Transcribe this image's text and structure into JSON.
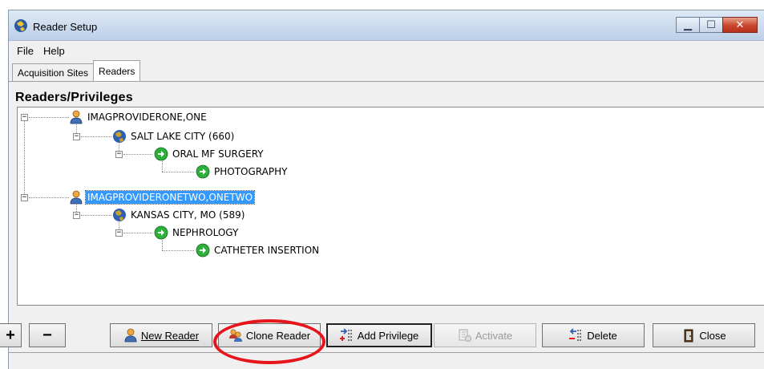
{
  "window": {
    "title": "Reader Setup",
    "controls": {
      "minimize": "▁",
      "maximize": "☐",
      "close": "✕"
    }
  },
  "menu": [
    "File",
    "Help"
  ],
  "tabs": [
    {
      "label": "Acquisition Sites",
      "active": false
    },
    {
      "label": "Readers",
      "active": true
    }
  ],
  "section_title": "Readers/Privileges",
  "tree": {
    "nodes": [
      {
        "label": "IMAGPROVIDERONE,ONE",
        "icon": "person-icon",
        "selected": false
      },
      {
        "label": "SALT LAKE CITY (660)",
        "icon": "globe-icon",
        "selected": false
      },
      {
        "label": "ORAL MF SURGERY",
        "icon": "green-arrow-icon",
        "selected": false
      },
      {
        "label": "PHOTOGRAPHY",
        "icon": "green-arrow-icon",
        "selected": false
      },
      {
        "label": "IMAGPROVIDERONETWO,ONETWO",
        "icon": "person-icon",
        "selected": true
      },
      {
        "label": "KANSAS CITY, MO (589)",
        "icon": "globe-icon",
        "selected": false
      },
      {
        "label": "NEPHROLOGY",
        "icon": "green-arrow-icon",
        "selected": false
      },
      {
        "label": "CATHETER INSERTION",
        "icon": "green-arrow-icon",
        "selected": false
      }
    ]
  },
  "buttons": {
    "plus": "+",
    "minus": "−",
    "new_reader": "New Reader",
    "clone_reader": "Clone Reader",
    "add_privilege": "Add Privilege",
    "activate": "Activate",
    "delete": "Delete",
    "close": "Close"
  },
  "colors": {
    "selection": "#3399ff",
    "annotation": "#e8141c"
  }
}
